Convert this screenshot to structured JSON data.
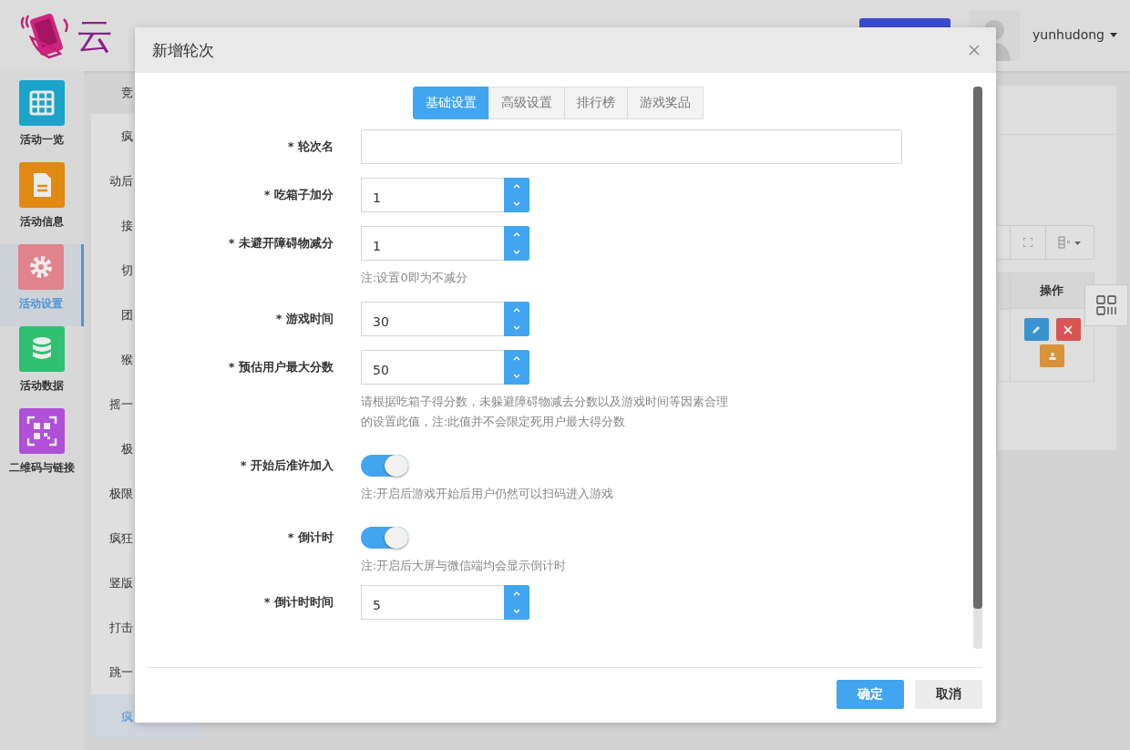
{
  "header": {
    "logo_text": "云",
    "username": "yunhudong"
  },
  "nav": [
    {
      "label": "活动一览",
      "color": "#1ba3c9",
      "selected": false
    },
    {
      "label": "活动信息",
      "color": "#e08a12",
      "selected": false
    },
    {
      "label": "活动设置",
      "color": "#e0838b",
      "selected": true
    },
    {
      "label": "活动数据",
      "color": "#2fbf71",
      "selected": false
    },
    {
      "label": "二维码与链接",
      "color": "#b04fd8",
      "selected": false
    }
  ],
  "submenu": [
    {
      "label": "竞",
      "selected": false
    },
    {
      "label": "疯",
      "selected": false
    },
    {
      "label": "动后",
      "selected": false
    },
    {
      "label": "接",
      "selected": false
    },
    {
      "label": "切",
      "selected": false
    },
    {
      "label": "团",
      "selected": false
    },
    {
      "label": "猴",
      "selected": false
    },
    {
      "label": "摇一",
      "selected": false
    },
    {
      "label": "极",
      "selected": false
    },
    {
      "label": "极限",
      "selected": false
    },
    {
      "label": "疯狂",
      "selected": false
    },
    {
      "label": "竖版",
      "selected": false
    },
    {
      "label": "打击",
      "selected": false
    },
    {
      "label": "跳一",
      "selected": false
    },
    {
      "label": "疯",
      "selected": true
    }
  ],
  "table": {
    "columns": [
      "操作"
    ]
  },
  "modal": {
    "title": "新增轮次",
    "tabs": [
      {
        "label": "基础设置",
        "selected": true
      },
      {
        "label": "高级设置",
        "selected": false
      },
      {
        "label": "排行榜",
        "selected": false
      },
      {
        "label": "游戏奖品",
        "selected": false
      }
    ],
    "fields": [
      {
        "kind": "text",
        "label": "* 轮次名"
      },
      {
        "kind": "number",
        "label": "* 吃箱子加分",
        "value": "1"
      },
      {
        "kind": "number",
        "label": "* 未避开障碍物减分",
        "value": "1",
        "hint": "注:设置0即为不减分"
      },
      {
        "kind": "number",
        "label": "* 游戏时间",
        "value": "30"
      },
      {
        "kind": "number",
        "label": "* 预估用户最大分数",
        "value": "50",
        "hint": "请根据吃箱子得分数，未躲避障碍物减去分数以及游戏时间等因素合理的设置此值，注:此值并不会限定死用户最大得分数"
      },
      {
        "kind": "toggle",
        "label": "* 开始后准许加入",
        "on": true,
        "hint": "注:开启后游戏开始后用户仍然可以扫码进入游戏"
      },
      {
        "kind": "toggle",
        "label": "* 倒计时",
        "on": true,
        "hint": "注:开启后大屏与微信端均会显示倒计时"
      },
      {
        "kind": "number",
        "label": "* 倒计时时间",
        "value": "5"
      }
    ],
    "buttons": [
      {
        "label": "确定",
        "kind": "primary"
      },
      {
        "label": "取消",
        "kind": "secondary"
      }
    ]
  }
}
